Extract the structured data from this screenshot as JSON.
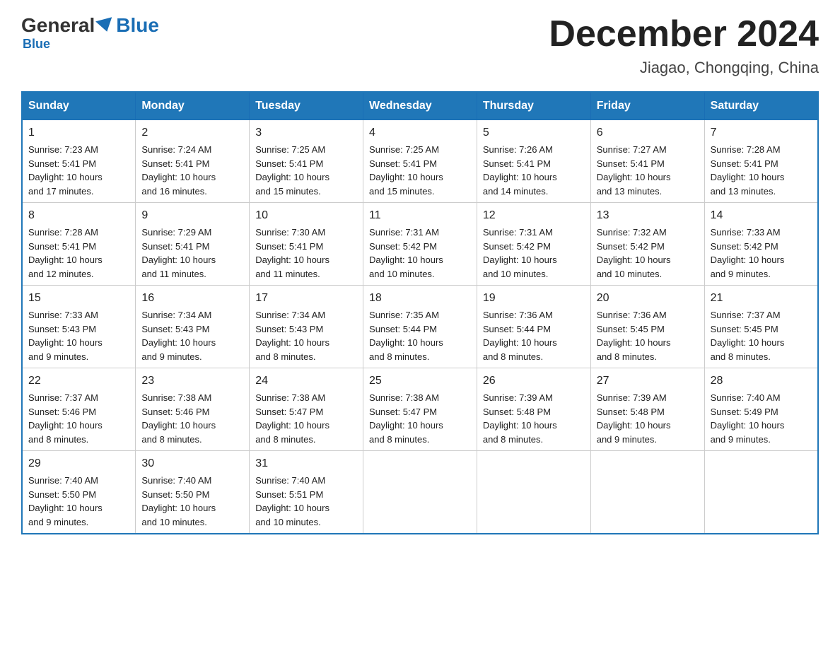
{
  "header": {
    "logo_general": "General",
    "logo_blue": "Blue",
    "month_title": "December 2024",
    "location": "Jiagao, Chongqing, China"
  },
  "days_of_week": [
    "Sunday",
    "Monday",
    "Tuesday",
    "Wednesday",
    "Thursday",
    "Friday",
    "Saturday"
  ],
  "weeks": [
    [
      {
        "day": "1",
        "sunrise": "7:23 AM",
        "sunset": "5:41 PM",
        "daylight": "10 hours and 17 minutes."
      },
      {
        "day": "2",
        "sunrise": "7:24 AM",
        "sunset": "5:41 PM",
        "daylight": "10 hours and 16 minutes."
      },
      {
        "day": "3",
        "sunrise": "7:25 AM",
        "sunset": "5:41 PM",
        "daylight": "10 hours and 15 minutes."
      },
      {
        "day": "4",
        "sunrise": "7:25 AM",
        "sunset": "5:41 PM",
        "daylight": "10 hours and 15 minutes."
      },
      {
        "day": "5",
        "sunrise": "7:26 AM",
        "sunset": "5:41 PM",
        "daylight": "10 hours and 14 minutes."
      },
      {
        "day": "6",
        "sunrise": "7:27 AM",
        "sunset": "5:41 PM",
        "daylight": "10 hours and 13 minutes."
      },
      {
        "day": "7",
        "sunrise": "7:28 AM",
        "sunset": "5:41 PM",
        "daylight": "10 hours and 13 minutes."
      }
    ],
    [
      {
        "day": "8",
        "sunrise": "7:28 AM",
        "sunset": "5:41 PM",
        "daylight": "10 hours and 12 minutes."
      },
      {
        "day": "9",
        "sunrise": "7:29 AM",
        "sunset": "5:41 PM",
        "daylight": "10 hours and 11 minutes."
      },
      {
        "day": "10",
        "sunrise": "7:30 AM",
        "sunset": "5:41 PM",
        "daylight": "10 hours and 11 minutes."
      },
      {
        "day": "11",
        "sunrise": "7:31 AM",
        "sunset": "5:42 PM",
        "daylight": "10 hours and 10 minutes."
      },
      {
        "day": "12",
        "sunrise": "7:31 AM",
        "sunset": "5:42 PM",
        "daylight": "10 hours and 10 minutes."
      },
      {
        "day": "13",
        "sunrise": "7:32 AM",
        "sunset": "5:42 PM",
        "daylight": "10 hours and 10 minutes."
      },
      {
        "day": "14",
        "sunrise": "7:33 AM",
        "sunset": "5:42 PM",
        "daylight": "10 hours and 9 minutes."
      }
    ],
    [
      {
        "day": "15",
        "sunrise": "7:33 AM",
        "sunset": "5:43 PM",
        "daylight": "10 hours and 9 minutes."
      },
      {
        "day": "16",
        "sunrise": "7:34 AM",
        "sunset": "5:43 PM",
        "daylight": "10 hours and 9 minutes."
      },
      {
        "day": "17",
        "sunrise": "7:34 AM",
        "sunset": "5:43 PM",
        "daylight": "10 hours and 8 minutes."
      },
      {
        "day": "18",
        "sunrise": "7:35 AM",
        "sunset": "5:44 PM",
        "daylight": "10 hours and 8 minutes."
      },
      {
        "day": "19",
        "sunrise": "7:36 AM",
        "sunset": "5:44 PM",
        "daylight": "10 hours and 8 minutes."
      },
      {
        "day": "20",
        "sunrise": "7:36 AM",
        "sunset": "5:45 PM",
        "daylight": "10 hours and 8 minutes."
      },
      {
        "day": "21",
        "sunrise": "7:37 AM",
        "sunset": "5:45 PM",
        "daylight": "10 hours and 8 minutes."
      }
    ],
    [
      {
        "day": "22",
        "sunrise": "7:37 AM",
        "sunset": "5:46 PM",
        "daylight": "10 hours and 8 minutes."
      },
      {
        "day": "23",
        "sunrise": "7:38 AM",
        "sunset": "5:46 PM",
        "daylight": "10 hours and 8 minutes."
      },
      {
        "day": "24",
        "sunrise": "7:38 AM",
        "sunset": "5:47 PM",
        "daylight": "10 hours and 8 minutes."
      },
      {
        "day": "25",
        "sunrise": "7:38 AM",
        "sunset": "5:47 PM",
        "daylight": "10 hours and 8 minutes."
      },
      {
        "day": "26",
        "sunrise": "7:39 AM",
        "sunset": "5:48 PM",
        "daylight": "10 hours and 8 minutes."
      },
      {
        "day": "27",
        "sunrise": "7:39 AM",
        "sunset": "5:48 PM",
        "daylight": "10 hours and 9 minutes."
      },
      {
        "day": "28",
        "sunrise": "7:40 AM",
        "sunset": "5:49 PM",
        "daylight": "10 hours and 9 minutes."
      }
    ],
    [
      {
        "day": "29",
        "sunrise": "7:40 AM",
        "sunset": "5:50 PM",
        "daylight": "10 hours and 9 minutes."
      },
      {
        "day": "30",
        "sunrise": "7:40 AM",
        "sunset": "5:50 PM",
        "daylight": "10 hours and 10 minutes."
      },
      {
        "day": "31",
        "sunrise": "7:40 AM",
        "sunset": "5:51 PM",
        "daylight": "10 hours and 10 minutes."
      },
      null,
      null,
      null,
      null
    ]
  ],
  "labels": {
    "sunrise": "Sunrise:",
    "sunset": "Sunset:",
    "daylight": "Daylight:"
  }
}
